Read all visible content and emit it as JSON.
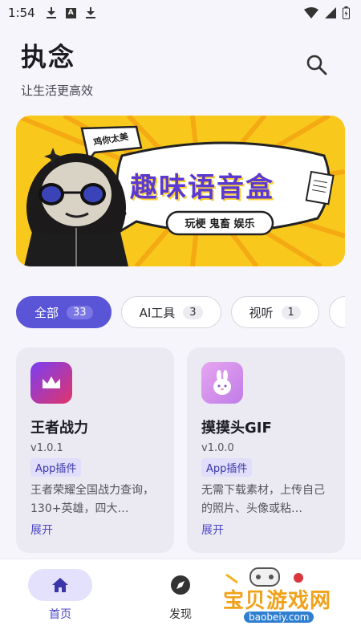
{
  "status_bar": {
    "time": "1:54"
  },
  "header": {
    "title": "执念",
    "subtitle": "让生活更高效"
  },
  "banner": {
    "bubble": "鸡你太美",
    "title": "趣味语音盒",
    "tagline": "玩梗 鬼畜 娱乐"
  },
  "filters": [
    {
      "label": "全部",
      "count": "33",
      "active": true
    },
    {
      "label": "AI工具",
      "count": "3"
    },
    {
      "label": "视听",
      "count": "1"
    }
  ],
  "cards": [
    {
      "name": "王者战力",
      "version": "v1.0.1",
      "tag": "App插件",
      "desc": "王者荣耀全国战力查询，130+英雄，四大…",
      "expand": "展开",
      "icon": "crown-icon",
      "color_from": "#7b3ff2",
      "color_to": "#e0346a"
    },
    {
      "name": "摸摸头GIF",
      "version": "v1.0.0",
      "tag": "App插件",
      "desc": "无需下载素材，上传自己的照片、头像或粘…",
      "expand": "展开",
      "icon": "rabbit-icon",
      "color_from": "#e7a6f0",
      "color_to": "#c07ce8"
    }
  ],
  "nav": [
    {
      "label": "首页",
      "icon": "home-icon",
      "active": true
    },
    {
      "label": "发现",
      "icon": "compass-icon"
    },
    {
      "label": "",
      "icon": ""
    }
  ],
  "watermark": {
    "title": "宝贝游戏网",
    "url": "baobeiy.com"
  },
  "colors": {
    "primary": "#5a55d6",
    "card_bg": "#ebeaf2",
    "banner_bg": "#f9c81d"
  }
}
